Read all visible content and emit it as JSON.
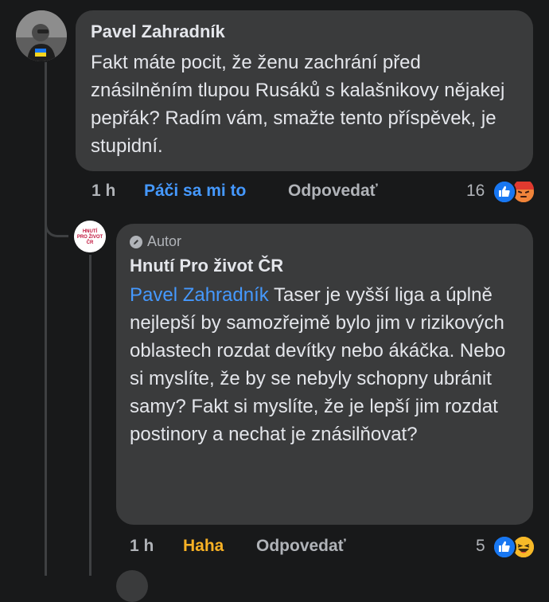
{
  "comments": [
    {
      "author": "Pavel Zahradník",
      "text": "Fakt máte pocit, že ženu zachrání před znásilněním tlupou Rusáků s kalašnikovy nějakej pepřák? Radím vám, smažte tento příspěvek, je stupidní.",
      "time": "1 h",
      "like_label": "Páči sa mi to",
      "reply_label": "Odpovedať",
      "reaction_count": "16",
      "reactions": [
        "like-icon",
        "angry-icon"
      ]
    }
  ],
  "reply": {
    "badge": "Autor",
    "author": "Hnutí Pro život ČR",
    "avatar_text": "HNUTÍ PRO ŽIVOT ČR",
    "mention": "Pavel Zahradník",
    "text": " Taser je vyšší liga a úplně nejlepší by samozřejmě bylo jim v rizikových oblastech rozdat devítky nebo ákáčka. Nebo si myslíte, že by se nebyly schopny ubránit samy? Fakt si myslíte, že je lepší jim rozdat postinory a nechat je znásilňovat?",
    "time": "1 h",
    "reaction_label": "Haha",
    "reply_label": "Odpovedať",
    "reaction_count": "5",
    "reactions": [
      "like-icon",
      "haha-icon"
    ]
  },
  "colors": {
    "background": "#18191a",
    "bubble": "#3a3b3c",
    "link": "#4599ff",
    "haha": "#f7b125"
  }
}
